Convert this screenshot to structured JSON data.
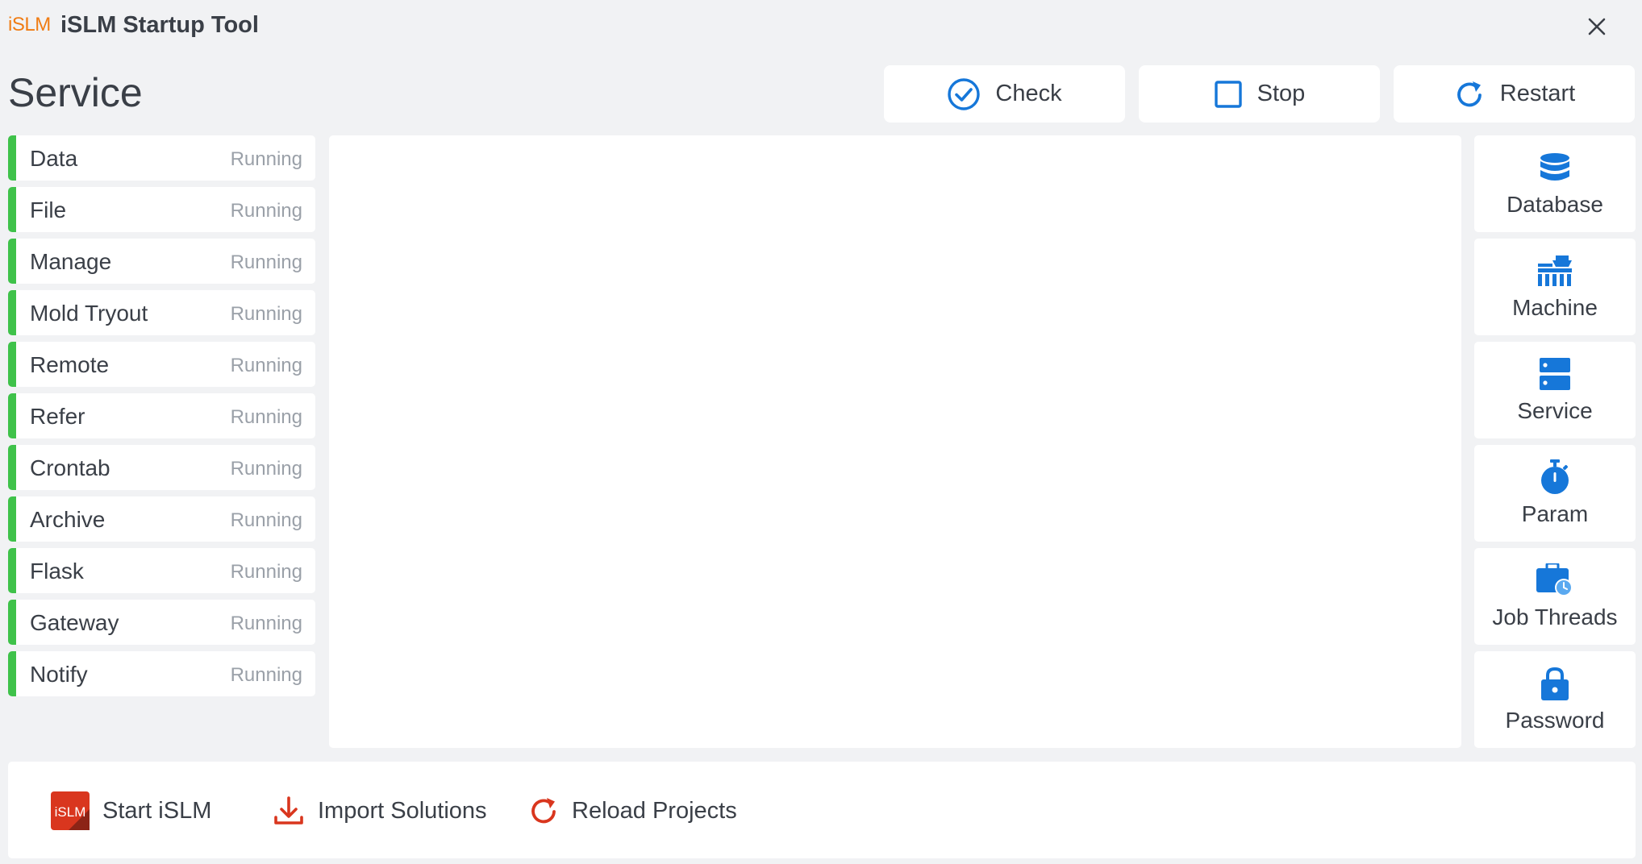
{
  "titlebar": {
    "logo_text": "iSLM",
    "title": "iSLM Startup Tool"
  },
  "page": {
    "title": "Service"
  },
  "actions": [
    {
      "label": "Check",
      "icon": "check-circle-icon"
    },
    {
      "label": "Stop",
      "icon": "stop-square-icon"
    },
    {
      "label": "Restart",
      "icon": "refresh-icon"
    }
  ],
  "services": [
    {
      "name": "Data",
      "status": "Running"
    },
    {
      "name": "File",
      "status": "Running"
    },
    {
      "name": "Manage",
      "status": "Running"
    },
    {
      "name": "Mold Tryout",
      "status": "Running"
    },
    {
      "name": "Remote",
      "status": "Running"
    },
    {
      "name": "Refer",
      "status": "Running"
    },
    {
      "name": "Crontab",
      "status": "Running"
    },
    {
      "name": "Archive",
      "status": "Running"
    },
    {
      "name": "Flask",
      "status": "Running"
    },
    {
      "name": "Gateway",
      "status": "Running"
    },
    {
      "name": "Notify",
      "status": "Running"
    }
  ],
  "tools": [
    {
      "label": "Database",
      "icon": "database-icon"
    },
    {
      "label": "Machine",
      "icon": "machine-icon"
    },
    {
      "label": "Service",
      "icon": "server-icon"
    },
    {
      "label": "Param",
      "icon": "stopwatch-icon"
    },
    {
      "label": "Job Threads",
      "icon": "briefcase-clock-icon"
    },
    {
      "label": "Password",
      "icon": "lock-icon"
    }
  ],
  "footer": {
    "start_label": "Start iSLM",
    "start_logo_text": "iSLM",
    "import_label": "Import Solutions",
    "reload_label": "Reload Projects"
  },
  "colors": {
    "accent_blue": "#1677d9",
    "running_green": "#3fc24a",
    "logo_orange": "#f07c13",
    "footer_red": "#d9361e"
  }
}
